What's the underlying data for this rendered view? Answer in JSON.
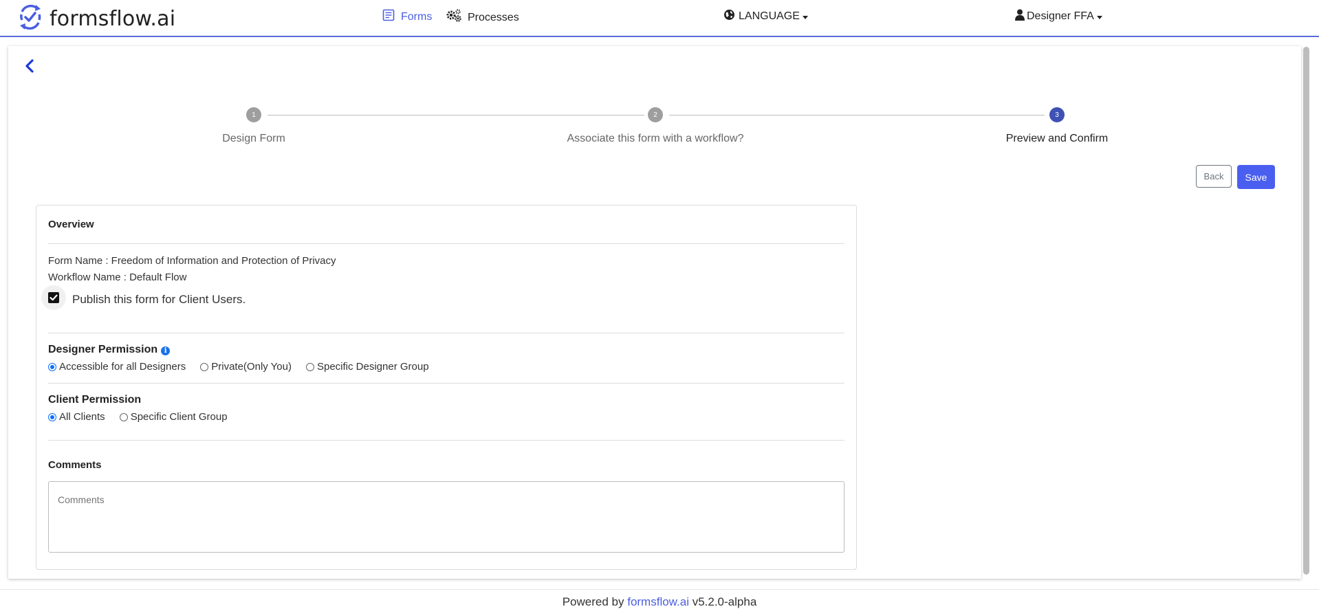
{
  "nav": {
    "brand": "formsflow.ai",
    "forms": "Forms",
    "processes": "Processes",
    "language": "LANGUAGE",
    "user": "Designer FFA",
    "accent": "#4a5ee0"
  },
  "stepper": {
    "steps": [
      {
        "number": "1",
        "label": "Design Form",
        "state": "complete"
      },
      {
        "number": "2",
        "label": "Associate this form with a workflow?",
        "state": "complete"
      },
      {
        "number": "3",
        "label": "Preview and Confirm",
        "state": "active"
      }
    ]
  },
  "actions": {
    "back": "Back",
    "save": "Save"
  },
  "overview": {
    "title": "Overview",
    "form_name": "Form Name : Freedom of Information and Protection of Privacy",
    "workflow_name": "Workflow Name : Default Flow",
    "publish_label": "Publish this form for Client Users.",
    "publish_checked": true
  },
  "designer_permission": {
    "title": "Designer Permission",
    "options": [
      {
        "label": "Accessible for all Designers",
        "selected": true
      },
      {
        "label": "Private(Only You)",
        "selected": false
      },
      {
        "label": "Specific Designer Group",
        "selected": false
      }
    ]
  },
  "client_permission": {
    "title": "Client Permission",
    "options": [
      {
        "label": "All Clients",
        "selected": true
      },
      {
        "label": "Specific Client Group",
        "selected": false
      }
    ]
  },
  "comments": {
    "title": "Comments",
    "placeholder": "Comments",
    "value": ""
  },
  "footer": {
    "prefix": "Powered by",
    "link": "formsflow.ai",
    "version": "v5.2.0-alpha"
  },
  "icons": [
    "formsflow-logo-icon",
    "forms-icon",
    "processes-gears-icon",
    "globe-icon",
    "user-icon",
    "back-chevron-icon",
    "info-icon",
    "checkbox-checked-icon"
  ]
}
